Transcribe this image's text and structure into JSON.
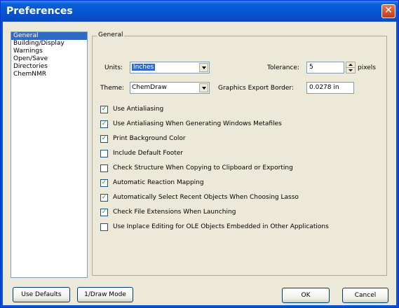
{
  "window": {
    "title": "Preferences"
  },
  "sidebar": {
    "items": [
      {
        "label": "General",
        "selected": true
      },
      {
        "label": "Building/Display"
      },
      {
        "label": "Warnings"
      },
      {
        "label": "Open/Save"
      },
      {
        "label": "Directories"
      },
      {
        "label": "ChemNMR"
      }
    ]
  },
  "general": {
    "group_label": "General",
    "units_label": "Units:",
    "units_value": "Inches",
    "theme_label": "Theme:",
    "theme_value": "ChemDraw",
    "tolerance_label": "Tolerance:",
    "tolerance_value": "5",
    "tolerance_unit": "pixels",
    "graphics_border_label": "Graphics Export Border:",
    "graphics_border_value": "0.0278 in",
    "checkboxes": [
      {
        "label": "Use Antialiasing",
        "checked": true
      },
      {
        "label": "Use Antialiasing When Generating Windows Metafiles",
        "checked": true
      },
      {
        "label": "Print Background Color",
        "checked": true
      },
      {
        "label": "Include Default Footer",
        "checked": false
      },
      {
        "label": "Check Structure When Copying to Clipboard or Exporting",
        "checked": false
      },
      {
        "label": "Automatic Reaction Mapping",
        "checked": true
      },
      {
        "label": "Automatically Select Recent Objects When Choosing Lasso",
        "checked": true
      },
      {
        "label": "Check File Extensions When Launching",
        "checked": true
      },
      {
        "label": "Use Inplace Editing for OLE Objects Embedded in Other Applications",
        "checked": false
      }
    ]
  },
  "buttons": {
    "use_defaults": "Use Defaults",
    "draw_mode": "1/Draw Mode",
    "ok": "OK",
    "cancel": "Cancel"
  },
  "colors": {
    "titlebar": "#0553d0",
    "dialog_bg": "#ece9d8",
    "selection": "#316ac5",
    "close": "#c23b18"
  }
}
